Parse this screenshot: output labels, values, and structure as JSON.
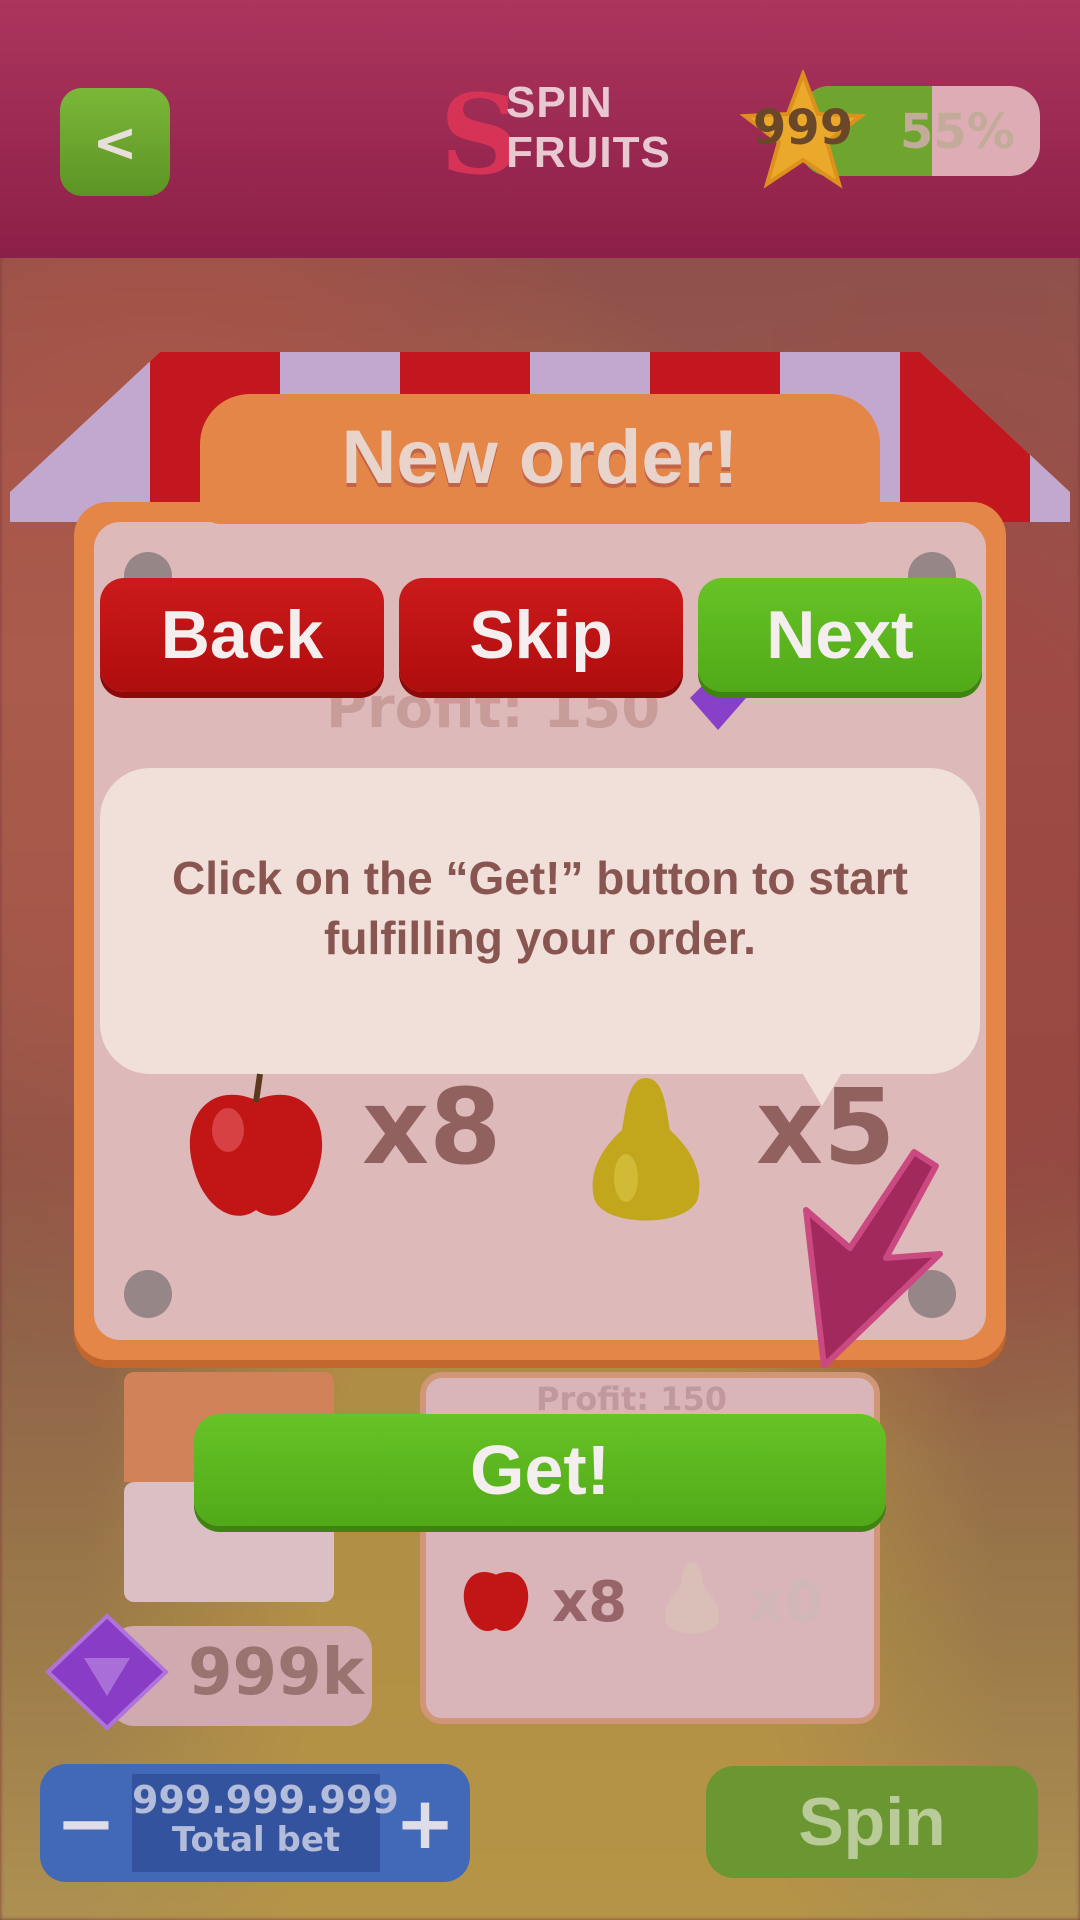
{
  "header": {
    "back_label": "<",
    "logo_letter": "S",
    "logo_line1": "SPIN",
    "logo_line2": "FRUITS",
    "level": "999",
    "xp_text": "55%",
    "xp_progress_percent": 55
  },
  "panel": {
    "title": "New order!",
    "profit_text": "Profit: 150"
  },
  "tutorial": {
    "back_label": "Back",
    "skip_label": "Skip",
    "next_label": "Next",
    "message": "Click on the “Get!” button to start fulfilling your order."
  },
  "order_items": [
    {
      "fruit": "apple",
      "qty": "x8"
    },
    {
      "fruit": "pear",
      "qty": "x5"
    }
  ],
  "get_button": "Get!",
  "second_order": {
    "profit_text": "Profit: 150",
    "items": [
      {
        "fruit": "apple",
        "qty": "x8"
      },
      {
        "fruit": "pear",
        "qty": "x0"
      }
    ]
  },
  "footer": {
    "balance": "999k",
    "bet_value": "999.999.999",
    "bet_label": "Total bet",
    "minus_label": "−",
    "plus_label": "+",
    "spin_label": "Spin"
  },
  "colors": {
    "top_bar": "#a12a57",
    "red_button": "#c81010",
    "green_button": "#5cc31e",
    "panel_orange": "#ee8f4a",
    "bubble": "#fbf0e8",
    "text_brown": "#8b5a54"
  }
}
